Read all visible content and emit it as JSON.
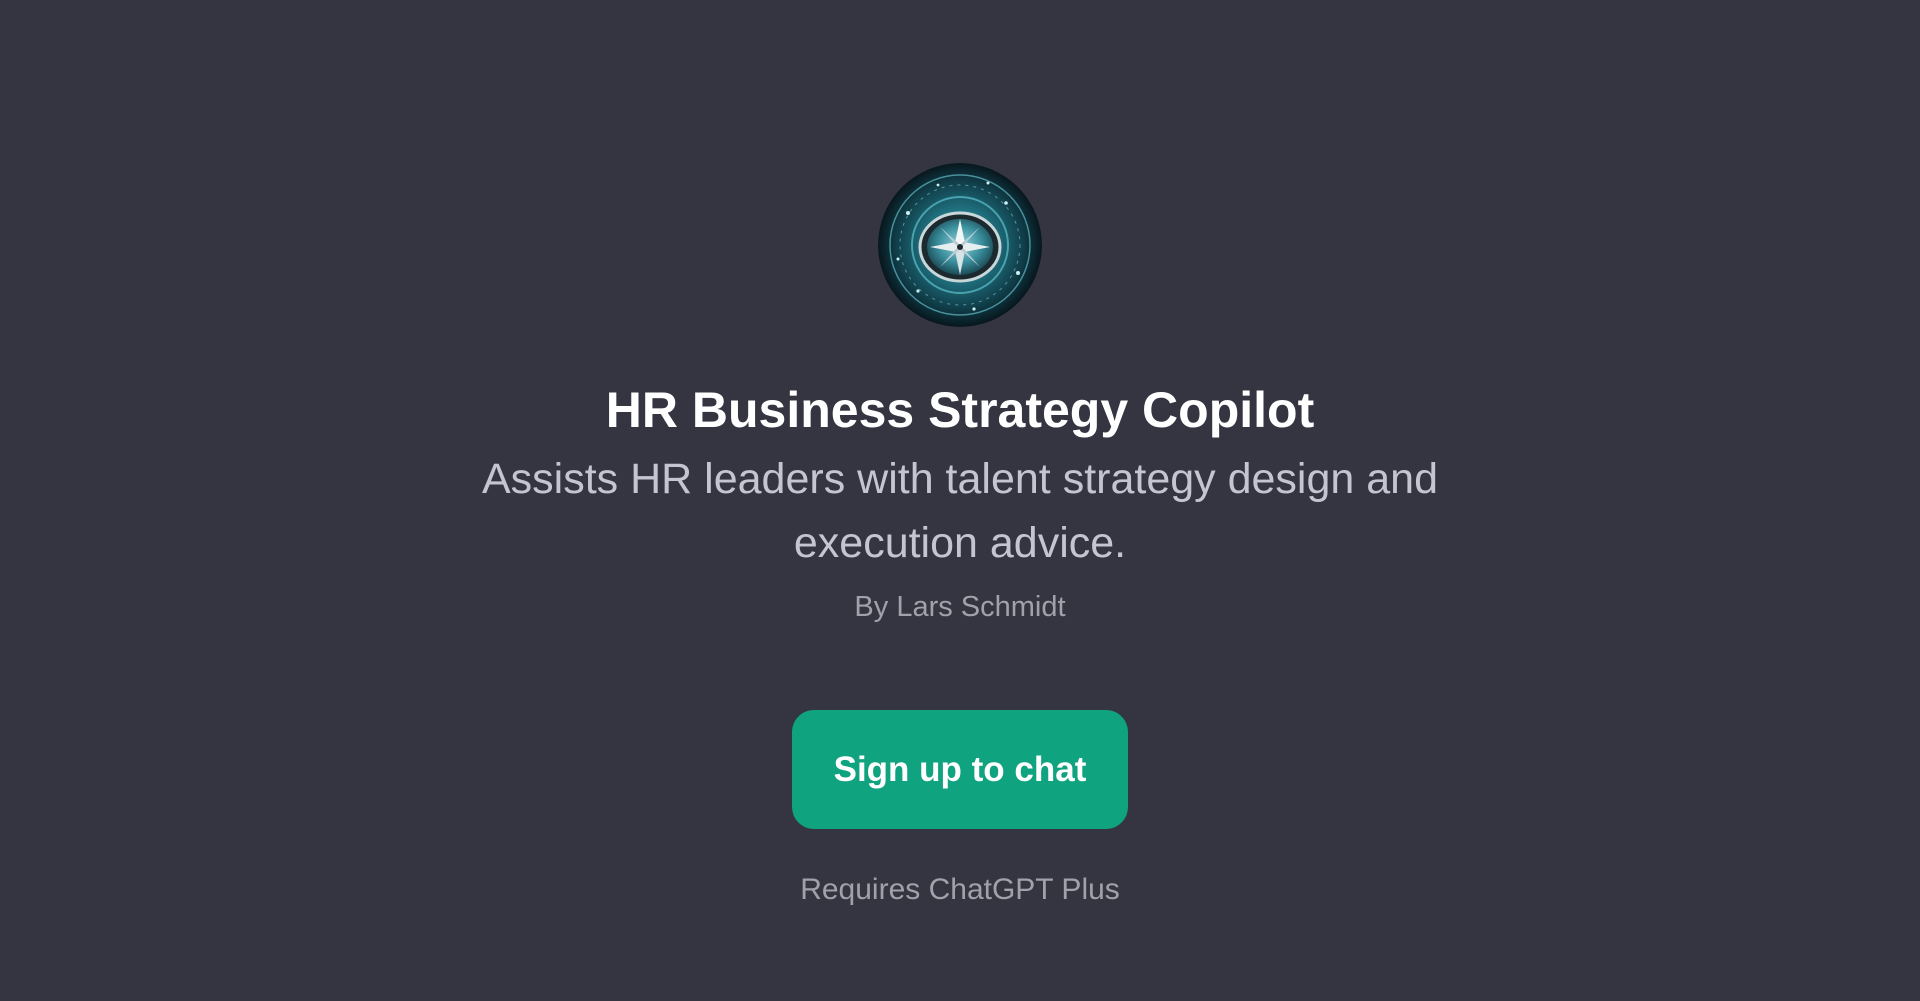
{
  "gpt": {
    "avatar_icon": "compass-icon",
    "title": "HR Business Strategy Copilot",
    "description": "Assists HR leaders with talent strategy design and execution advice.",
    "author": "By Lars Schmidt"
  },
  "cta": {
    "label": "Sign up to chat"
  },
  "requirement": "Requires ChatGPT Plus",
  "colors": {
    "background": "#343541",
    "button": "#10a37f",
    "title": "#ffffff",
    "description": "#c5c5d2",
    "muted": "#a1a1aa"
  }
}
